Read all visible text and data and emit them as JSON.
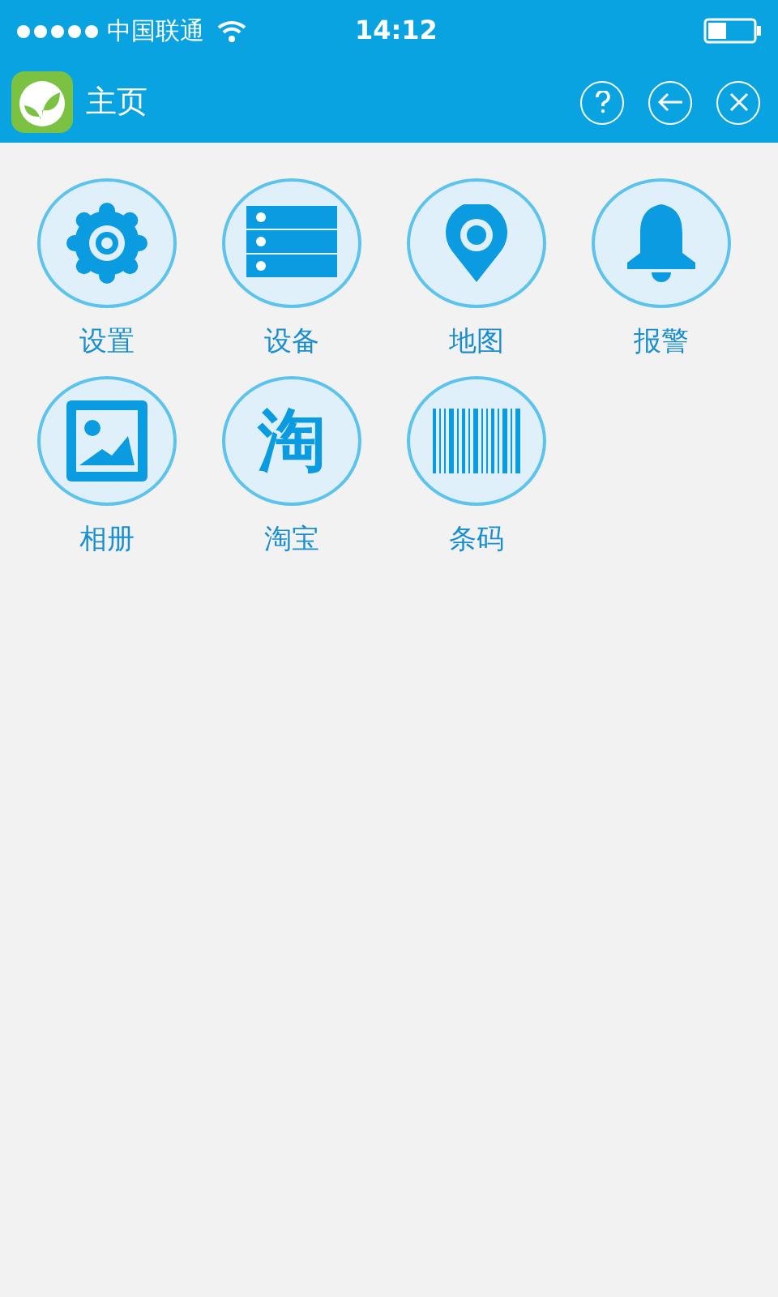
{
  "status_bar": {
    "carrier": "中国联通",
    "time": "14:12"
  },
  "header": {
    "title": "主页"
  },
  "tiles": [
    {
      "kind": "gear",
      "label": "设置"
    },
    {
      "kind": "server",
      "label": "设备"
    },
    {
      "kind": "pin",
      "label": "地图"
    },
    {
      "kind": "bell",
      "label": "报警"
    },
    {
      "kind": "picture",
      "label": "相册"
    },
    {
      "kind": "glyph",
      "glyph": "淘",
      "label": "淘宝"
    },
    {
      "kind": "barcode",
      "label": "条码"
    }
  ]
}
